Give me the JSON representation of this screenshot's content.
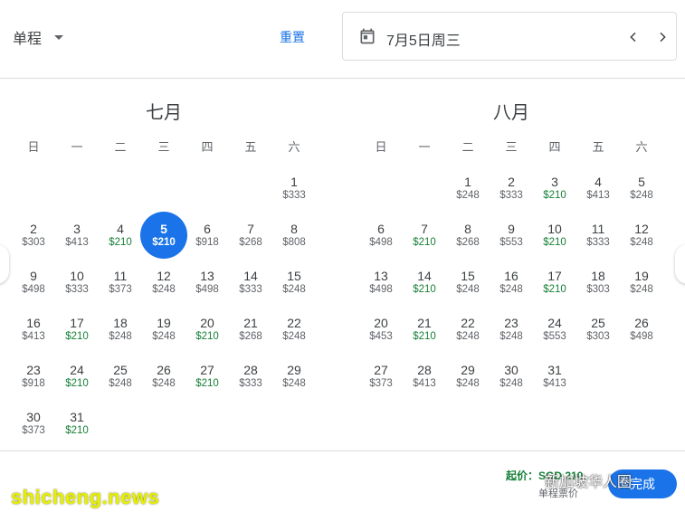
{
  "header": {
    "trip_type": "单程",
    "reset_label": "重置",
    "selected_date": "7月5日周三"
  },
  "weekdays": [
    "日",
    "一",
    "二",
    "三",
    "四",
    "五",
    "六"
  ],
  "months": [
    {
      "title": "七月",
      "first_weekday": 6,
      "days": [
        {
          "d": "1",
          "p": "$333",
          "low": false
        },
        {
          "d": "2",
          "p": "$303",
          "low": false
        },
        {
          "d": "3",
          "p": "$413",
          "low": false
        },
        {
          "d": "4",
          "p": "$210",
          "low": true
        },
        {
          "d": "5",
          "p": "$210",
          "low": true,
          "selected": true
        },
        {
          "d": "6",
          "p": "$918",
          "low": false
        },
        {
          "d": "7",
          "p": "$268",
          "low": false
        },
        {
          "d": "8",
          "p": "$808",
          "low": false
        },
        {
          "d": "9",
          "p": "$498",
          "low": false
        },
        {
          "d": "10",
          "p": "$333",
          "low": false
        },
        {
          "d": "11",
          "p": "$373",
          "low": false
        },
        {
          "d": "12",
          "p": "$248",
          "low": false
        },
        {
          "d": "13",
          "p": "$498",
          "low": false
        },
        {
          "d": "14",
          "p": "$333",
          "low": false
        },
        {
          "d": "15",
          "p": "$248",
          "low": false
        },
        {
          "d": "16",
          "p": "$413",
          "low": false
        },
        {
          "d": "17",
          "p": "$210",
          "low": true
        },
        {
          "d": "18",
          "p": "$248",
          "low": false
        },
        {
          "d": "19",
          "p": "$248",
          "low": false
        },
        {
          "d": "20",
          "p": "$210",
          "low": true
        },
        {
          "d": "21",
          "p": "$268",
          "low": false
        },
        {
          "d": "22",
          "p": "$248",
          "low": false
        },
        {
          "d": "23",
          "p": "$918",
          "low": false
        },
        {
          "d": "24",
          "p": "$210",
          "low": true
        },
        {
          "d": "25",
          "p": "$248",
          "low": false
        },
        {
          "d": "26",
          "p": "$248",
          "low": false
        },
        {
          "d": "27",
          "p": "$210",
          "low": true
        },
        {
          "d": "28",
          "p": "$333",
          "low": false
        },
        {
          "d": "29",
          "p": "$248",
          "low": false
        },
        {
          "d": "30",
          "p": "$373",
          "low": false
        },
        {
          "d": "31",
          "p": "$210",
          "low": true
        }
      ]
    },
    {
      "title": "八月",
      "first_weekday": 2,
      "days": [
        {
          "d": "1",
          "p": "$248",
          "low": false
        },
        {
          "d": "2",
          "p": "$333",
          "low": false
        },
        {
          "d": "3",
          "p": "$210",
          "low": true
        },
        {
          "d": "4",
          "p": "$413",
          "low": false
        },
        {
          "d": "5",
          "p": "$248",
          "low": false
        },
        {
          "d": "6",
          "p": "$498",
          "low": false
        },
        {
          "d": "7",
          "p": "$210",
          "low": true
        },
        {
          "d": "8",
          "p": "$268",
          "low": false
        },
        {
          "d": "9",
          "p": "$553",
          "low": false
        },
        {
          "d": "10",
          "p": "$210",
          "low": true
        },
        {
          "d": "11",
          "p": "$333",
          "low": false
        },
        {
          "d": "12",
          "p": "$248",
          "low": false
        },
        {
          "d": "13",
          "p": "$498",
          "low": false
        },
        {
          "d": "14",
          "p": "$210",
          "low": true
        },
        {
          "d": "15",
          "p": "$248",
          "low": false
        },
        {
          "d": "16",
          "p": "$248",
          "low": false
        },
        {
          "d": "17",
          "p": "$210",
          "low": true
        },
        {
          "d": "18",
          "p": "$303",
          "low": false
        },
        {
          "d": "19",
          "p": "$248",
          "low": false
        },
        {
          "d": "20",
          "p": "$453",
          "low": false
        },
        {
          "d": "21",
          "p": "$210",
          "low": true
        },
        {
          "d": "22",
          "p": "$248",
          "low": false
        },
        {
          "d": "23",
          "p": "$248",
          "low": false
        },
        {
          "d": "24",
          "p": "$553",
          "low": false
        },
        {
          "d": "25",
          "p": "$303",
          "low": false
        },
        {
          "d": "26",
          "p": "$498",
          "low": false
        },
        {
          "d": "27",
          "p": "$373",
          "low": false
        },
        {
          "d": "28",
          "p": "$413",
          "low": false
        },
        {
          "d": "29",
          "p": "$248",
          "low": false
        },
        {
          "d": "30",
          "p": "$248",
          "low": false
        },
        {
          "d": "31",
          "p": "$413",
          "low": false
        }
      ]
    }
  ],
  "footer": {
    "from_price": "起价：SGD 210",
    "oneway_note": "单程票价",
    "done_label": "完成"
  },
  "watermark": {
    "site": "shicheng.news",
    "account": "新加坡华人圈"
  },
  "colors": {
    "accent": "#1a73e8",
    "low_price": "#188038"
  },
  "icons": [
    "chevron-down-icon",
    "calendar-icon",
    "chevron-left-icon",
    "chevron-right-icon"
  ]
}
